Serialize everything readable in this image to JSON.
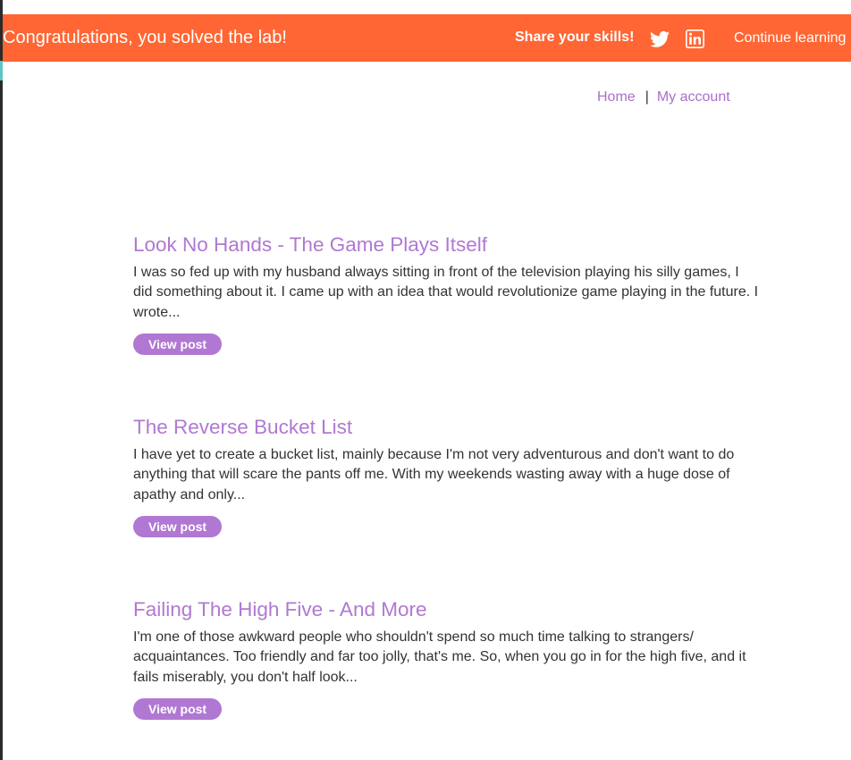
{
  "banner": {
    "message": "Congratulations, you solved the lab!",
    "share_label": "Share your skills!",
    "twitter_icon": "twitter-icon",
    "linkedin_icon": "linkedin-icon",
    "continue_label": "Continue learning",
    "color": "#ff6633"
  },
  "nav": {
    "home": "Home",
    "separator": "|",
    "account": "My account"
  },
  "accent_color": "#b078d2",
  "posts": [
    {
      "title": "Look No Hands - The Game Plays Itself",
      "summary": "I was so fed up with my husband always sitting in front of the television playing his silly games, I did something about it. I came up with an idea that would revolutionize game playing in the future. I wrote...",
      "button": "View post"
    },
    {
      "title": "The Reverse Bucket List",
      "summary": "I have yet to create a bucket list, mainly because I'm not very adventurous and don't want to do anything that will scare the pants off me. With my weekends wasting away with a huge dose of apathy and only...",
      "button": "View post"
    },
    {
      "title": "Failing The High Five - And More",
      "summary": "I'm one of those awkward people who shouldn't spend so much time talking to strangers/ acquaintances. Too friendly and far too jolly, that's me. So, when you go in for the high five, and it fails miserably, you don't half look...",
      "button": "View post"
    }
  ]
}
